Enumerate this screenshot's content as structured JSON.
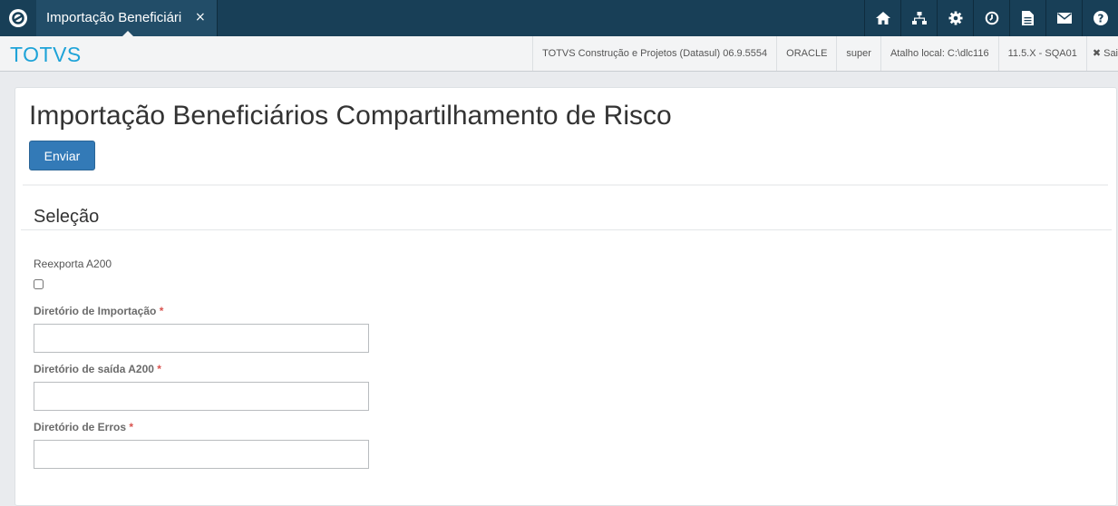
{
  "topbar": {
    "logo_icon": "totvs-logo-icon",
    "tab": {
      "label": "Importação Beneficiári",
      "close": "×"
    },
    "icons": [
      "home-icon",
      "sitemap-icon",
      "gear-icon",
      "clock-icon",
      "document-icon",
      "mail-icon",
      "help-icon"
    ]
  },
  "secbar": {
    "brand": "TOTVS",
    "product": "TOTVS Construção e Projetos (Datasul) 06.9.5554",
    "database": "ORACLE",
    "user": "super",
    "shortcut": "Atalho local: C:\\dlc116",
    "version": "11.5.X - SQA01",
    "exit": "✖ Sai"
  },
  "page": {
    "title": "Importação Beneficiários Compartilhamento de Risco",
    "send_button": "Enviar"
  },
  "section": {
    "title": "Seleção",
    "reexport_label": "Reexporta A200",
    "reexport_checked": false,
    "required_mark": "*",
    "fields": [
      {
        "label": "Diretório de Importação",
        "value": ""
      },
      {
        "label": "Diretório de saída A200",
        "value": ""
      },
      {
        "label": "Diretório de Erros",
        "value": ""
      }
    ]
  },
  "colors": {
    "topbar": "#183f57",
    "tab": "#224d68",
    "brand": "#1ea3d8",
    "primary_button": "#337ab7",
    "required": "#d9534f"
  }
}
